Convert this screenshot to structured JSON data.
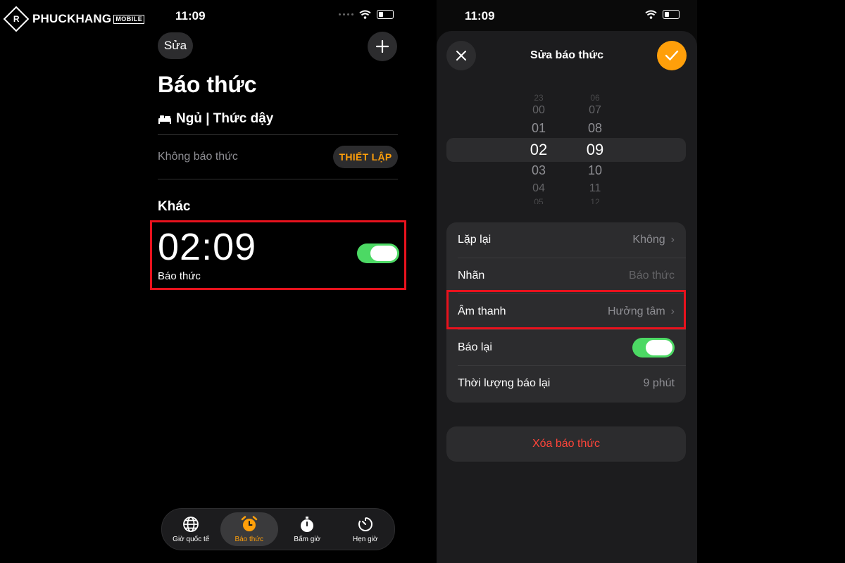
{
  "logo": {
    "text": "PHUCKHANG",
    "sub": "MOBILE",
    "mark": "R"
  },
  "left_phone": {
    "status_time": "11:09",
    "edit_label": "Sửa",
    "title": "Báo thức",
    "sleep_title": "Ngủ | Thức dậy",
    "no_alarm_text": "Không báo thức",
    "setup_label": "THIẾT LẬP",
    "other_section": "Khác",
    "alarm": {
      "time": "02:09",
      "label": "Báo thức",
      "enabled": true
    },
    "tabs": [
      {
        "label": "Giờ quốc tế",
        "icon": "globe-icon",
        "active": false
      },
      {
        "label": "Báo thức",
        "icon": "alarm-clock-icon",
        "active": true
      },
      {
        "label": "Bấm giờ",
        "icon": "stopwatch-icon",
        "active": false
      },
      {
        "label": "Hẹn giờ",
        "icon": "timer-icon",
        "active": false
      }
    ]
  },
  "right_phone": {
    "status_time": "11:09",
    "header_title": "Sửa báo thức",
    "picker": {
      "hours": [
        "23",
        "00",
        "01",
        "02",
        "03",
        "04",
        "05"
      ],
      "minutes": [
        "06",
        "07",
        "08",
        "09",
        "10",
        "11",
        "12"
      ],
      "selected_hour": "02",
      "selected_minute": "09"
    },
    "rows": {
      "repeat": {
        "label": "Lặp lại",
        "value": "Không"
      },
      "name": {
        "label": "Nhãn",
        "value": "Báo thức"
      },
      "sound": {
        "label": "Âm thanh",
        "value": "Hưởng tâm"
      },
      "snooze": {
        "label": "Báo lại",
        "enabled": true
      },
      "snooze_duration": {
        "label": "Thời lượng báo lại",
        "value": "9 phút"
      }
    },
    "delete_label": "Xóa báo thức"
  },
  "colors": {
    "accent": "#ff9f0a",
    "toggle_on": "#4cd964",
    "highlight": "#e8121d",
    "danger": "#ff453a"
  }
}
